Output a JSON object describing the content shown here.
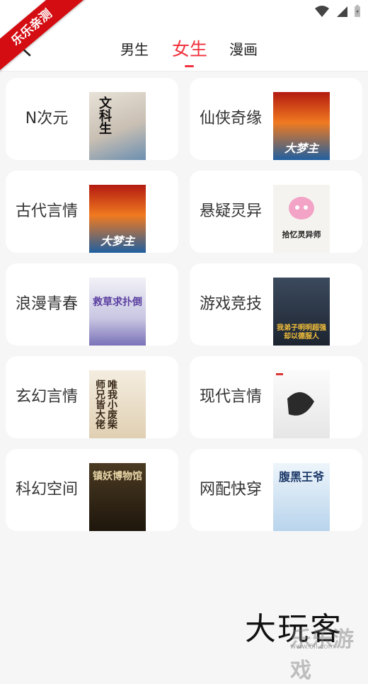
{
  "ribbon": {
    "text": "乐乐亲测"
  },
  "header": {
    "tabs": [
      {
        "label": "男生",
        "active": false
      },
      {
        "label": "女生",
        "active": true
      },
      {
        "label": "漫画",
        "active": false
      }
    ]
  },
  "colors": {
    "accent": "#f0323c",
    "ribbon": "#d40d12",
    "text": "#333333",
    "card_bg": "#ffffff",
    "page_bg": "#f6f6f6"
  },
  "categories": [
    {
      "label": "N次元",
      "cover_title": "文科生"
    },
    {
      "label": "仙侠奇缘",
      "cover_title": "大梦主"
    },
    {
      "label": "古代言情",
      "cover_title": "大梦主"
    },
    {
      "label": "悬疑灵异",
      "cover_title": "拾忆灵异师"
    },
    {
      "label": "浪漫青春",
      "cover_title": "救草求扑倒"
    },
    {
      "label": "游戏竞技",
      "cover_title": "我弟子明明超强却以德服人"
    },
    {
      "label": "玄幻言情",
      "cover_title": "唯我小废柴 师兄皆大佬"
    },
    {
      "label": "现代言情",
      "cover_title": ""
    },
    {
      "label": "科幻空间",
      "cover_title": "镇妖博物馆"
    },
    {
      "label": "网配快穿",
      "cover_title": "腹黑王爷"
    }
  ],
  "watermark": {
    "text": "大玩客",
    "sub": "乐乐游戏",
    "url": "www.6ll.com"
  }
}
